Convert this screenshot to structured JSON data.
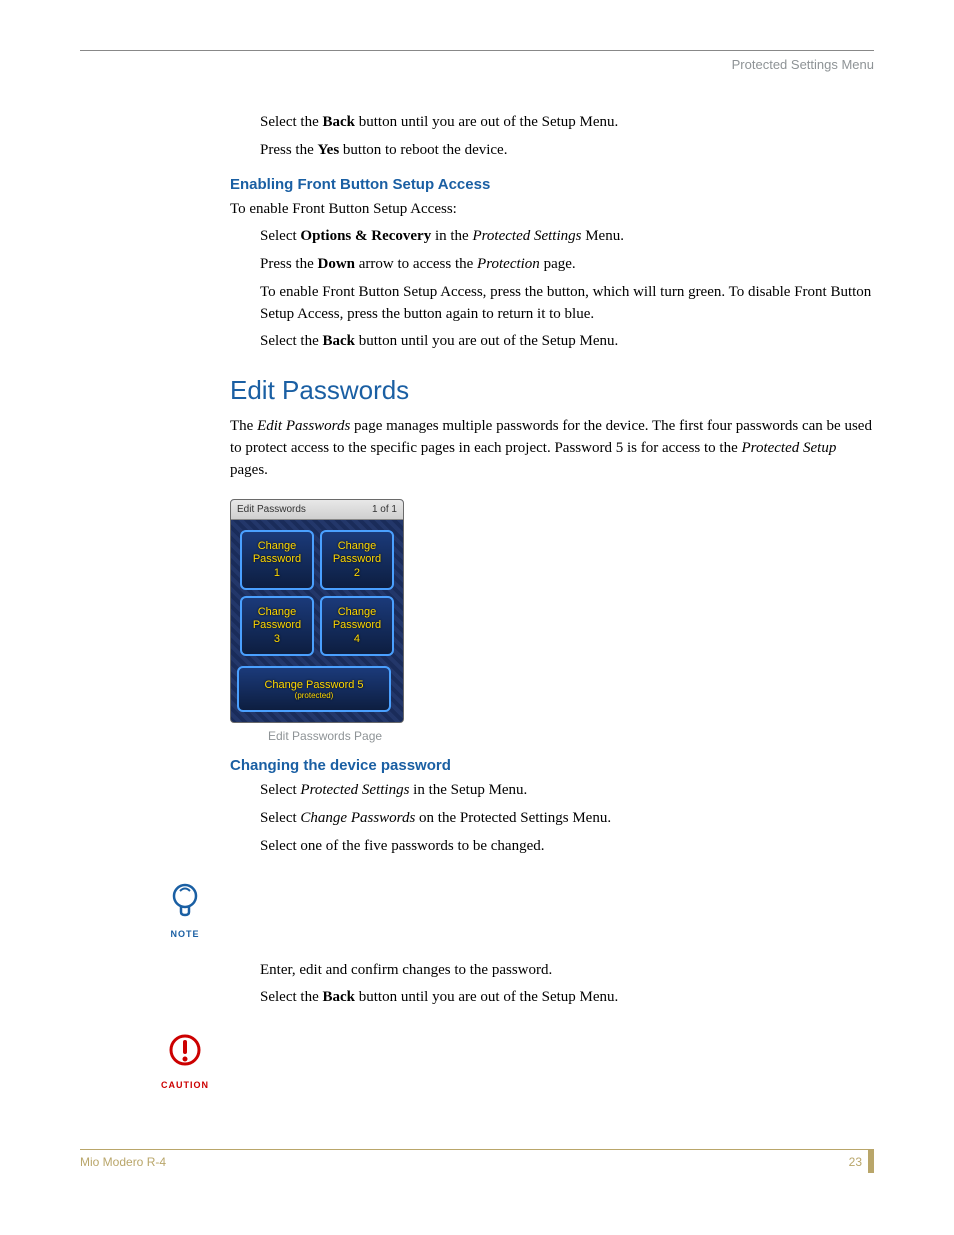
{
  "header": {
    "right": "Protected Settings Menu"
  },
  "intro": {
    "p1_pre": "Select the ",
    "p1_b": "Back",
    "p1_post": " button until you are out of the Setup Menu.",
    "p2_pre": "Press the ",
    "p2_b": "Yes",
    "p2_post": " button to reboot the device."
  },
  "h_enable": "Enabling Front Button Setup Access",
  "enable": {
    "lead": "To enable Front Button Setup Access:",
    "s1_pre": "Select ",
    "s1_b": "Options & Recovery",
    "s1_mid": " in the ",
    "s1_i": "Protected Settings",
    "s1_post": " Menu.",
    "s2_pre": "Press the ",
    "s2_b": "Down",
    "s2_mid": " arrow to access the ",
    "s2_i": "Protection",
    "s2_post": " page.",
    "s3": "To enable Front Button Setup Access, press the button, which will turn green.  To disable Front Button Setup Access, press the button again to return it to blue.",
    "s4_pre": "Select the ",
    "s4_b": "Back",
    "s4_post": " button until you are out of the Setup Menu."
  },
  "h_edit": "Edit Passwords",
  "edit_desc": {
    "pre": "The ",
    "i1": "Edit Passwords",
    "mid1": " page manages multiple passwords for the device. The first four passwords can be used to protect access to the specific pages in each project. Password 5 is for access to the ",
    "i2": "Protected Setup",
    "post": " pages."
  },
  "panel": {
    "title": "Edit Passwords",
    "page": "1 of 1",
    "b1": "Change\nPassword\n1",
    "b2": "Change\nPassword\n2",
    "b3": "Change\nPassword\n3",
    "b4": "Change\nPassword\n4",
    "b5_l1": "Change Password 5",
    "b5_l2": "(protected)"
  },
  "fig_caption": "Edit Passwords Page",
  "h_change": "Changing the device password",
  "change": {
    "s1_pre": "Select ",
    "s1_i": "Protected Settings",
    "s1_post": " in the Setup Menu.",
    "s2_pre": "Select ",
    "s2_i": "Change Passwords",
    "s2_post": " on the Protected Settings Menu.",
    "s3": "Select one of the five passwords to be changed."
  },
  "note_label": "NOTE",
  "after_note": {
    "p1": "Enter, edit and confirm changes to the password.",
    "p2_pre": "Select the ",
    "p2_b": "Back",
    "p2_post": " button until you are out of the Setup Menu."
  },
  "caution_label": "CAUTION",
  "footer": {
    "left": "Mio Modero R-4",
    "right": "23"
  }
}
